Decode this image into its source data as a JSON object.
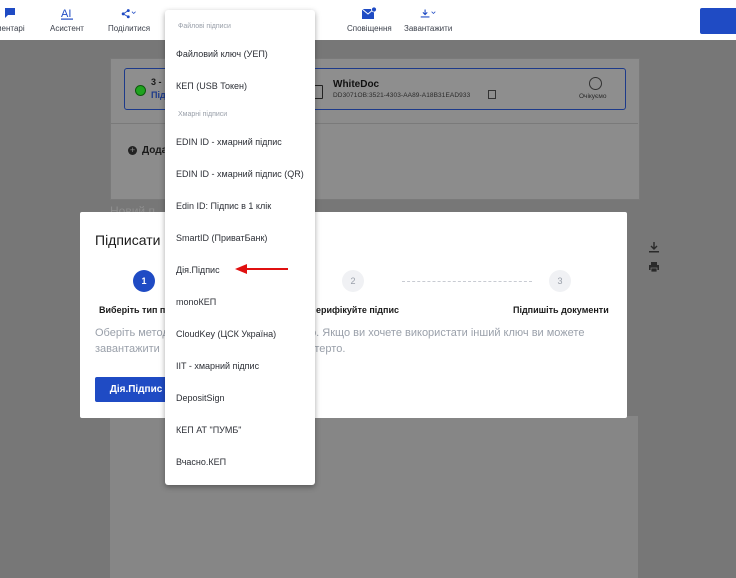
{
  "toolbar": {
    "items": [
      {
        "label": "ментарі",
        "icon": "comment-icon"
      },
      {
        "label": "Асистент",
        "icon": "ai-assistant-icon"
      },
      {
        "label": "Поділитися",
        "icon": "share-icon"
      },
      {
        "label": "Сповіщення",
        "icon": "mail-notification-icon"
      },
      {
        "label": "Завантажити",
        "icon": "download-icon"
      }
    ],
    "brand_color": "#1f4bc4"
  },
  "document_card": {
    "step_text": "3 -",
    "step_sub": "Під",
    "doc_name": "WhiteDoc",
    "doc_id": "DD3071OB:3521-4303-AA89-A18B31EAD933",
    "waiting_label": "Очікуємо",
    "add_label": "Дода",
    "new_sign_label": "Новий п"
  },
  "modal": {
    "title": "Підписати ,",
    "steps": [
      {
        "number": "1",
        "label": "Виберіть тип пі",
        "active": true
      },
      {
        "number": "2",
        "label": "ерифікуйте підпис",
        "active": false
      },
      {
        "number": "3",
        "label": "Підпишіть документи",
        "active": false
      }
    ],
    "description_line1": "Оберіть метод                                           ого. Якщо ви хочете використати інший ключ ви можете",
    "description_line2": "завантажити                                          уде стерто.",
    "button_label": "Дія.Підпис"
  },
  "dropdown": {
    "sections": [
      {
        "header": "Файлові підписи",
        "items": [
          "Файловий ключ (УЕП)",
          "КЕП (USB Токен)"
        ]
      },
      {
        "header": "Хмарні підписи",
        "items": [
          "EDIN ID - хмарний підпис",
          "EDIN ID - хмарний підпис (QR)",
          "Edin ID: Підпис в 1 клік",
          "SmartID (ПриватБанк)",
          "Дія.Підпис",
          "monoКЕП",
          "CloudKey (ЦСК Україна)",
          "IIT - хмарний підпис",
          "DepositSign",
          "КЕП АТ \"ПУМБ\"",
          "Вчасно.КЕП"
        ]
      }
    ]
  },
  "annotation": {
    "arrow_color": "#e01010",
    "points_to": "Дія.Підпис"
  }
}
